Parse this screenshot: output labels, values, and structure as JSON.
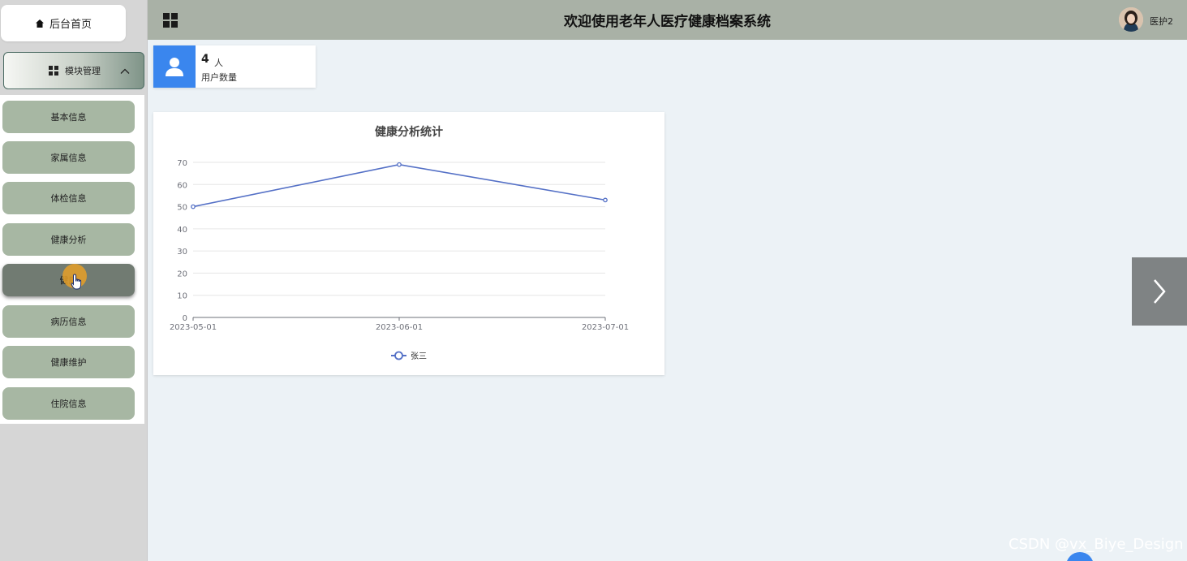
{
  "sidebar": {
    "home_label": "后台首页",
    "module_label": "模块管理",
    "items": [
      {
        "label": "基本信息"
      },
      {
        "label": "家属信息"
      },
      {
        "label": "体检信息"
      },
      {
        "label": "健康分析"
      },
      {
        "label": "健康"
      },
      {
        "label": "病历信息"
      },
      {
        "label": "健康维护"
      },
      {
        "label": "住院信息"
      }
    ],
    "active_index": 4
  },
  "header": {
    "title": "欢迎使用老年人医疗健康档案系统",
    "user_name": "医护2"
  },
  "stats": {
    "count": "4",
    "unit": "人",
    "label": "用户数量"
  },
  "chart_data": {
    "type": "line",
    "title": "健康分析统计",
    "x": [
      "2023-05-01",
      "2023-06-01",
      "2023-07-01"
    ],
    "series": [
      {
        "name": "张三",
        "values": [
          50,
          69,
          53
        ],
        "color": "#5470c6"
      }
    ],
    "ylim": [
      0,
      70
    ],
    "yticks": [
      0,
      10,
      20,
      30,
      40,
      50,
      60,
      70
    ],
    "grid": true,
    "legend": "bottom-center"
  },
  "watermark": "CSDN @vx_Biye_Design",
  "colors": {
    "header_bg": "#a9b1a6",
    "submenu_item": "#a7b7a3",
    "submenu_active": "#717b72",
    "accent_blue": "#3a86ee"
  }
}
